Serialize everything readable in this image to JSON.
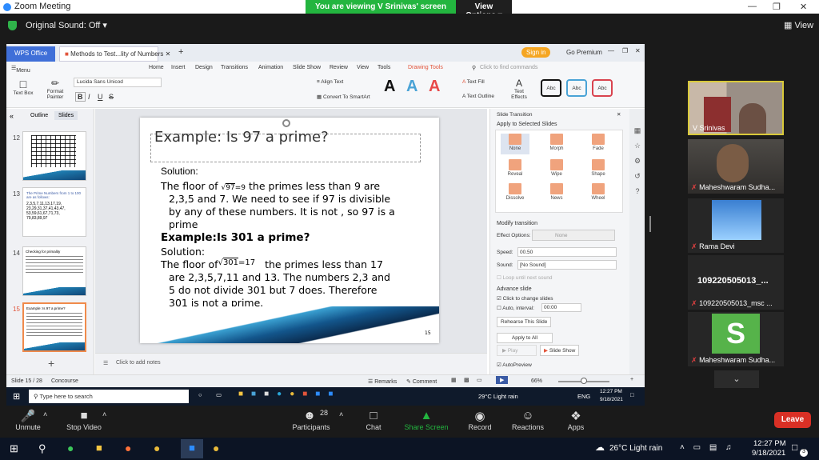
{
  "zoom": {
    "title": "Zoom Meeting",
    "banner_text": "You are viewing V Srinivas' screen",
    "view_options": "View Options",
    "original_sound": "Original Sound: Off",
    "view_label": "View"
  },
  "wps": {
    "app_tab": "WPS Office",
    "doc_tab": "Methods to Test...lity of Numbers",
    "sign_in": "Sign in",
    "go_premium": "Go Premium",
    "menu_label": "Menu",
    "menu_items": [
      "Home",
      "Insert",
      "Design",
      "Transitions",
      "Animation",
      "Slide Show",
      "Review",
      "View",
      "Tools",
      "Drawing Tools"
    ],
    "search_placeholder": "Click to find commands",
    "font_name": "Lucida Sans Unicod",
    "textbox_label": "Text Box",
    "format_painter": "Format Painter",
    "align_text": "Align Text",
    "convert_smartart": "Convert To SmartArt",
    "text_fill": "Text Fill",
    "text_outline": "Text Outline",
    "text_effects": "Text Effects",
    "style_sample": "Abc",
    "wordart_sample": "A",
    "outline_tab": "Outline",
    "slides_tab": "Slides",
    "thumbs": [
      {
        "num": "12"
      },
      {
        "num": "13",
        "title": "The Prime Numbers from 1 to 100 are as follows:",
        "lines": [
          "2,3,5,7,11,13,17,19,",
          "23,29,31,37,41,43,47,",
          "53,59,61,67,71,73,",
          "79,83,89,97"
        ]
      },
      {
        "num": "14",
        "title": "Checking for primality"
      },
      {
        "num": "15",
        "title": "Example: Is 97 a prime?"
      }
    ],
    "add_notes": "Click to add notes",
    "status_slide": "Slide 15 / 28",
    "status_theme": "Concourse",
    "remarks": "Remarks",
    "comment": "Comment",
    "zoom_level": "66%"
  },
  "slide": {
    "title": "Example: Is 97 a prime?",
    "solution1": "Solution:",
    "floor1_prefix": "The floor of",
    "sqrt1": "97",
    "sqrt1_result": "=9",
    "floor1_rest": "the primes less than 9 are",
    "line2": "2,3,5 and 7.  We need to see if 97 is divisible",
    "line3": "by any of these  numbers. It is not , so 97 is a",
    "line4": "prime",
    "heading2": "Example:Is 301 a prime?",
    "solution2": "Solution:",
    "floor2_prefix": "The floor of",
    "sqrt2": "301",
    "sqrt2_result": "=17",
    "floor2_rest": "the primes less than 17",
    "line6": "are  2,3,5,7,11 and 13.  The numbers 2,3 and",
    "line7": "5  do not divide 301 but 7 does. Therefore",
    "line8": "301  is not a prime.",
    "page_num": "15"
  },
  "transition_panel": {
    "title": "Slide Transition",
    "apply_selected": "Apply to Selected Slides",
    "transitions": [
      "None",
      "Morph",
      "Fade",
      "Reveal",
      "Wipe",
      "Shape",
      "Dissolve",
      "News",
      "Wheel"
    ],
    "modify": "Modify transition",
    "effect_options_label": "Effect Options:",
    "effect_options_value": "None",
    "speed_label": "Speed:",
    "speed_value": "00.50",
    "sound_label": "Sound:",
    "sound_value": "[No Sound]",
    "loop": "Loop until next sound",
    "advance": "Advance slide",
    "click_change": "Click to change slides",
    "auto_interval": "Auto, interval:",
    "interval_value": "00:00",
    "rehearse": "Rehearse This Slide",
    "apply_all": "Apply to All",
    "play": "Play",
    "slide_show": "Slide Show",
    "autopreview": "AutoPreview"
  },
  "inner_taskbar": {
    "search": "Type here to search",
    "weather": "29°C  Light rain",
    "lang": "ENG",
    "time": "12:27 PM",
    "date": "9/18/2021"
  },
  "participants_videos": [
    {
      "name": "V Srinivas"
    },
    {
      "name": "Maheshwaram Sudha..."
    },
    {
      "name": "Rama Devi"
    },
    {
      "name": "109220505013_...",
      "sub": "109220505013_msc ..."
    },
    {
      "name": "Maheshwaram Sudha...",
      "initial": "S"
    }
  ],
  "zoom_bar": {
    "unmute": "Unmute",
    "stop_video": "Stop Video",
    "participants": "Participants",
    "participants_count": "28",
    "chat": "Chat",
    "share_screen": "Share Screen",
    "record": "Record",
    "reactions": "Reactions",
    "apps": "Apps",
    "leave": "Leave"
  },
  "windows_taskbar": {
    "weather": "26°C  Light rain",
    "time": "12:27 PM",
    "date": "9/18/2021",
    "notif_count": "3"
  },
  "colors": {
    "zoom_green": "#23b53f",
    "wps_blue": "#3f6fd8",
    "leave_red": "#d93025",
    "selected_thumb": "#f08a4b"
  }
}
